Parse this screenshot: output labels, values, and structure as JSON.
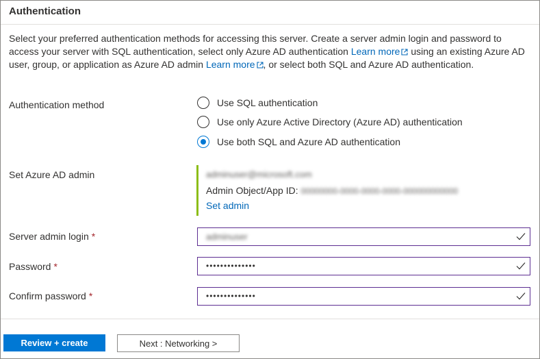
{
  "section": {
    "title": "Authentication",
    "description_part1": "Select your preferred authentication methods for accessing this server. Create a server admin login and password to access your server with SQL authentication, select only Azure AD authentication ",
    "learn_more_1": "Learn more",
    "description_part2": " using an existing Azure AD user, group, or application as Azure AD admin ",
    "learn_more_2": "Learn more",
    "description_part3": ", or select both SQL and Azure AD authentication."
  },
  "auth_method": {
    "label": "Authentication method",
    "options": [
      {
        "label": "Use SQL authentication",
        "selected": false
      },
      {
        "label": "Use only Azure Active Directory (Azure AD) authentication",
        "selected": false
      },
      {
        "label": "Use both SQL and Azure AD authentication",
        "selected": true
      }
    ]
  },
  "azure_ad_admin": {
    "label": "Set Azure AD admin",
    "email_blurred": "adminuser@microsoft.com",
    "object_id_label": "Admin Object/App ID:",
    "object_id_blurred": "00000000-0000-0000-0000-000000000000",
    "set_admin_link": "Set admin",
    "accent_color": "#8cbd18"
  },
  "server_admin_login": {
    "label": "Server admin login",
    "required_mark": "*",
    "value_blurred": "adminuser",
    "valid": true
  },
  "password": {
    "label": "Password",
    "required_mark": "*",
    "value": "••••••••••••••",
    "valid": true
  },
  "confirm_password": {
    "label": "Confirm password",
    "required_mark": "*",
    "value": "••••••••••••••",
    "valid": true
  },
  "footer": {
    "primary_button": "Review + create",
    "secondary_button": "Next : Networking >"
  },
  "colors": {
    "primary": "#0078d4",
    "link": "#0067b8",
    "required": "#a4262c",
    "input_border": "#5c2d91"
  }
}
